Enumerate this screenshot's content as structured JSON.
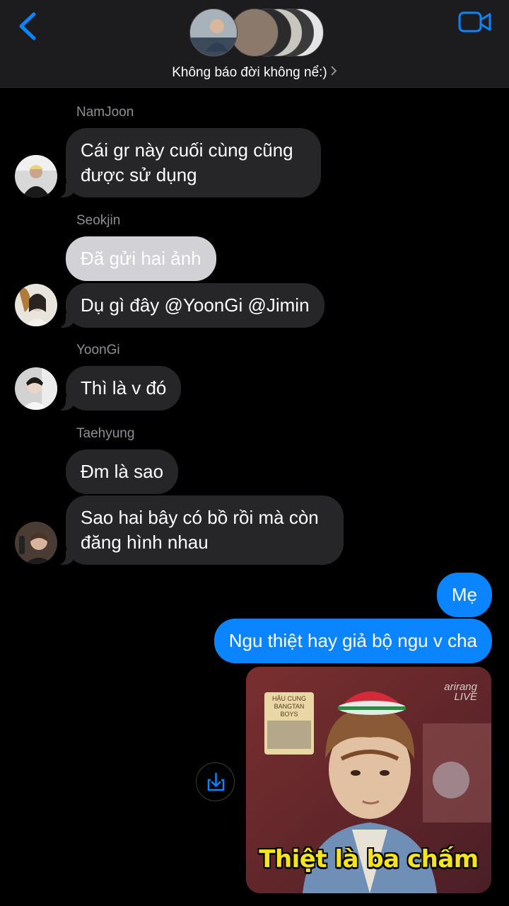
{
  "header": {
    "group_name": "Không báo đời không nể:)",
    "back_icon": "chevron-left-icon",
    "video_icon": "video-camera-icon",
    "accent_color": "#0a84ff"
  },
  "messages": [
    {
      "sender": "NamJoon",
      "lines": [
        "Cái gr này cuối cùng cũng",
        "được sử dụng"
      ]
    },
    {
      "sender": "Seokjin",
      "photo_text": "Đã gửi hai ảnh",
      "text": "Dụ gì đây @YoonGi @Jimin"
    },
    {
      "sender": "YoonGi",
      "text": "Thì là v đó"
    },
    {
      "sender": "Taehyung",
      "text": "Đm là sao",
      "lines": [
        "Sao hai bây có bồ rồi mà còn",
        "đăng hình nhau"
      ]
    }
  ],
  "my_messages": [
    {
      "text": "Mẹ"
    },
    {
      "text": "Ngu thiệt hay giả bộ ngu v cha"
    }
  ],
  "image": {
    "caption": "Thiệt là ba chấm",
    "watermark_top": "arirang",
    "watermark_bottom": "LIVE",
    "scroll_title": "HẬU CUNG",
    "scroll_sub": "BANGTAN BOYS"
  },
  "share_icon": "share-download-icon"
}
